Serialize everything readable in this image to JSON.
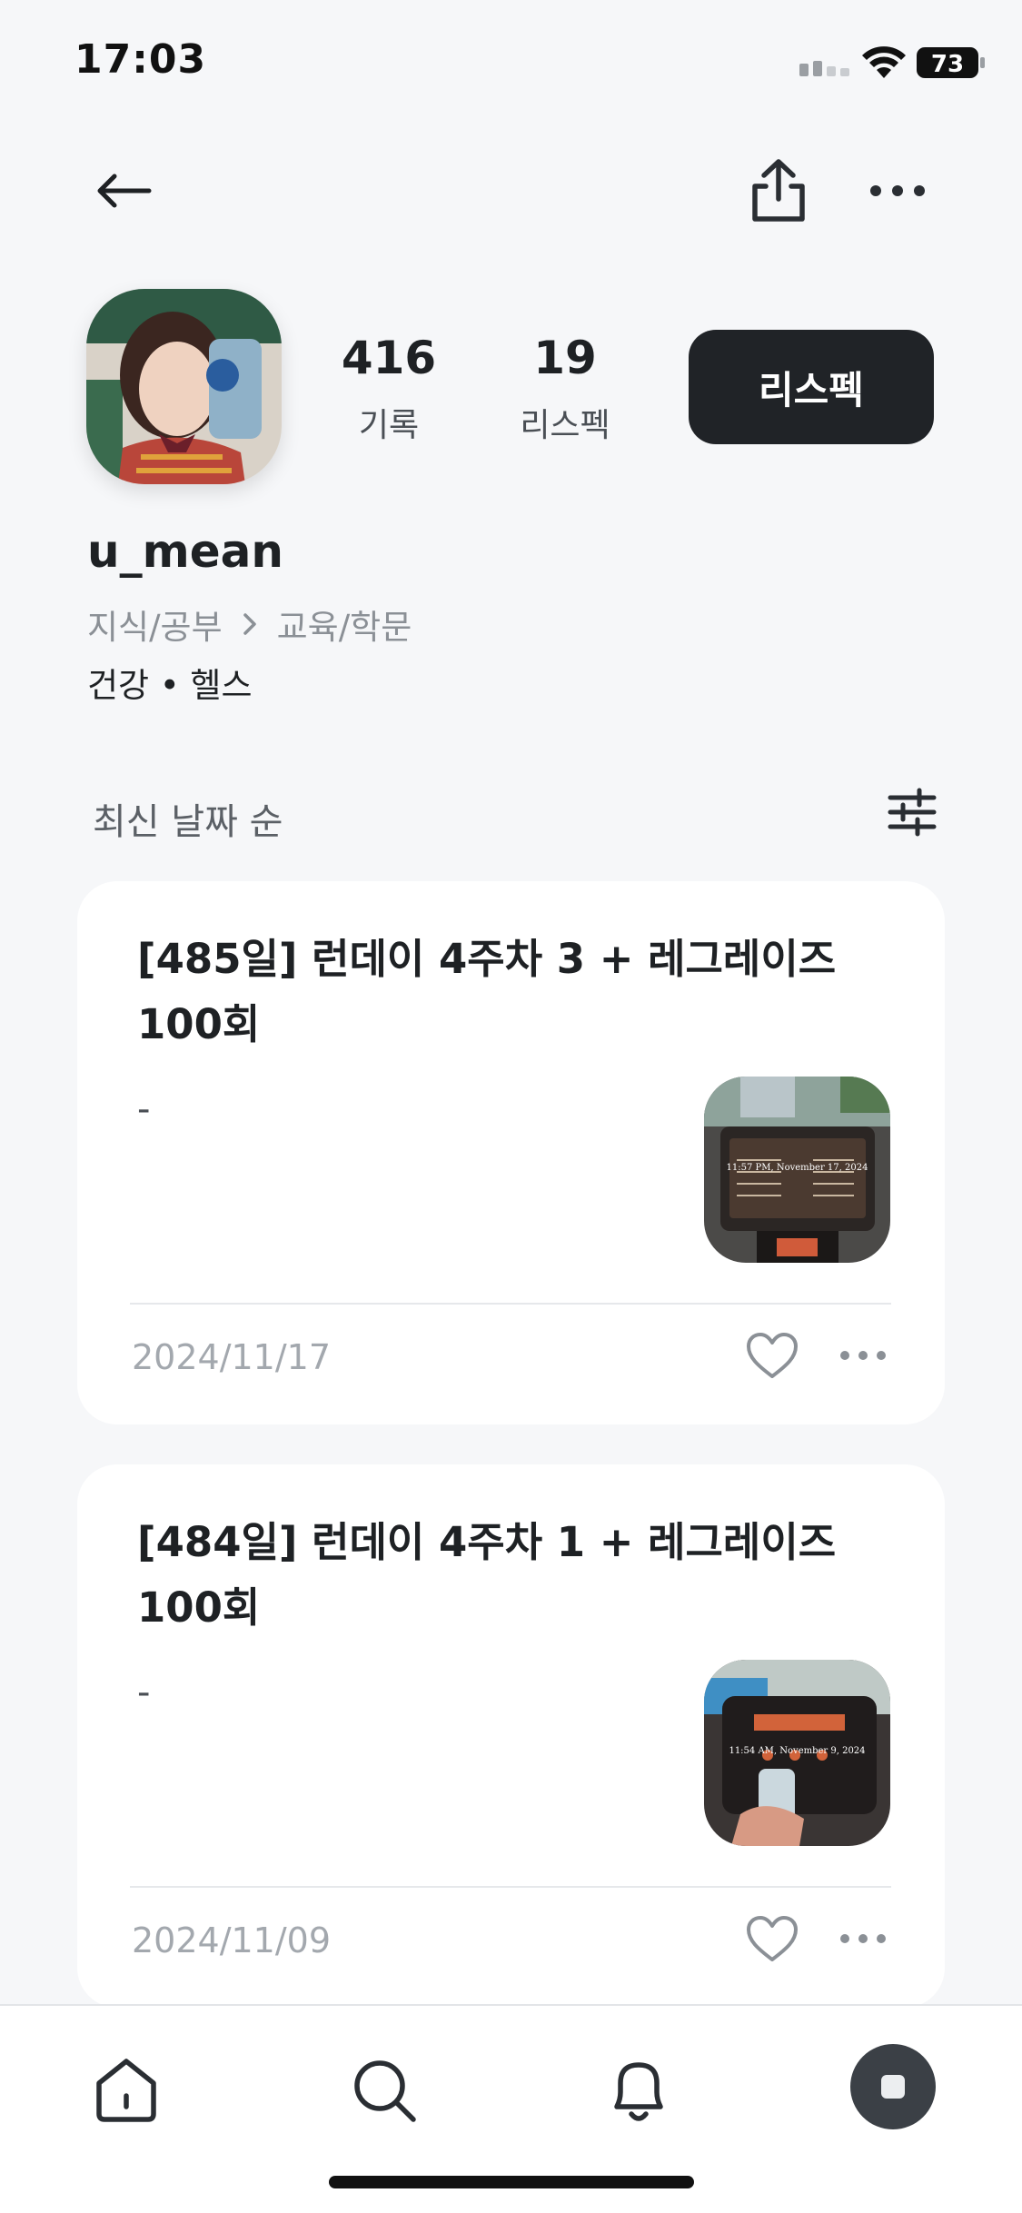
{
  "status_bar": {
    "time": "17:03",
    "battery": "73"
  },
  "header": {
    "back_icon": "arrow-left-icon",
    "share_icon": "share-icon",
    "more_icon": "more-horizontal-icon"
  },
  "profile": {
    "username": "u_mean",
    "stats": [
      {
        "value": "416",
        "label": "기록"
      },
      {
        "value": "19",
        "label": "리스펙"
      }
    ],
    "respect_button": "리스펙",
    "category": "지식/공부",
    "subcategory": "교육/학문",
    "tags": "건강 • 헬스"
  },
  "list": {
    "sort_label": "최신 날짜 순",
    "filter_icon": "sliders-icon",
    "posts": [
      {
        "title": "[485일] 런데이 4주차 3 + 레그레이즈 100회",
        "desc": "-",
        "date": "2024/11/17",
        "thumb_caption": "11:57 PM, November 17, 2024"
      },
      {
        "title": "[484일] 런데이 4주차 1 + 레그레이즈 100회",
        "desc": "-",
        "date": "2024/11/09",
        "thumb_caption": "11:54 AM, November 9, 2024"
      }
    ]
  },
  "tab_bar": {
    "items": [
      "home-icon",
      "search-icon",
      "bell-icon",
      "profile-icon"
    ]
  },
  "colors": {
    "background": "#f6f7f9",
    "button_dark": "#202327",
    "text_primary": "#1e2124",
    "text_muted": "#a3a8ae"
  }
}
